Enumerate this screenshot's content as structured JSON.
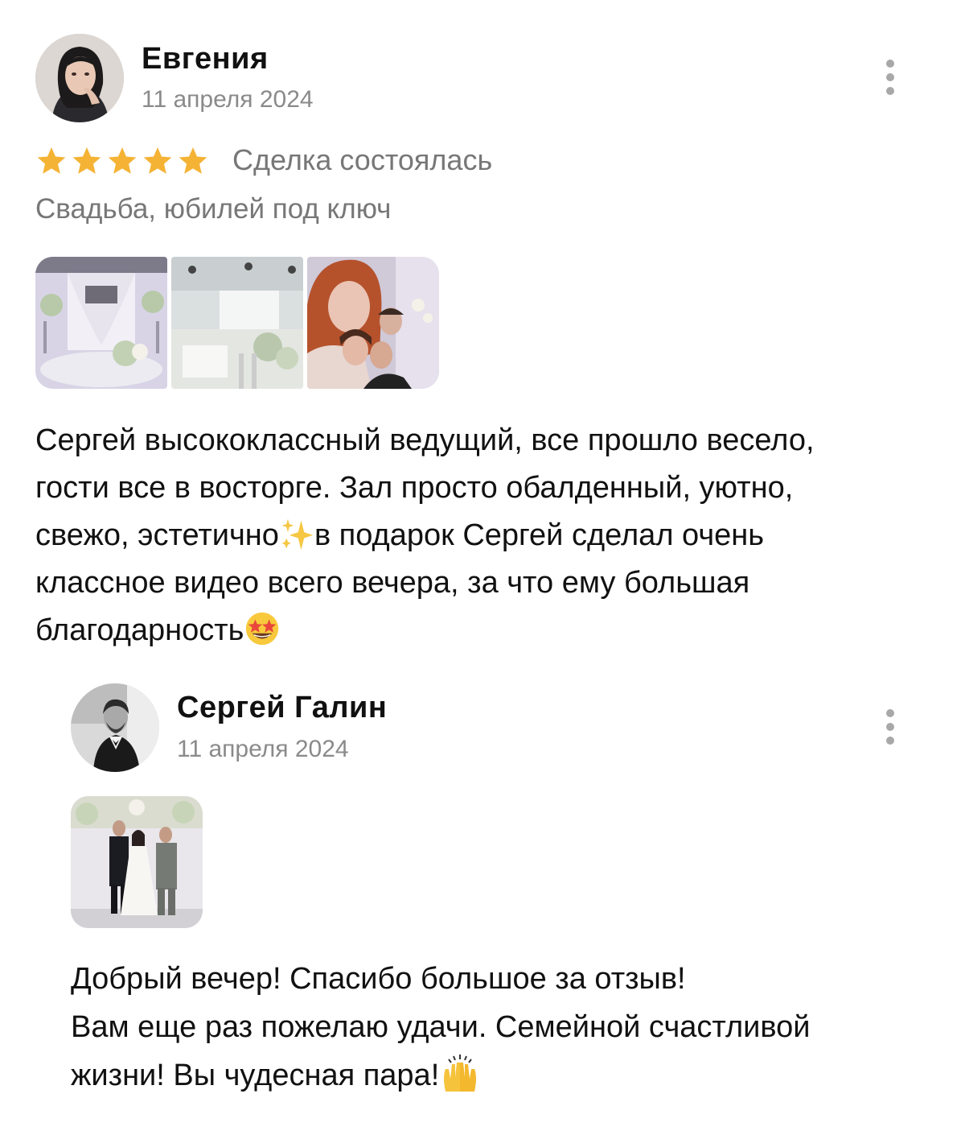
{
  "review": {
    "author": "Евгения",
    "date": "11 апреля 2024",
    "rating": 5,
    "deal_status": "Сделка состоялась",
    "service": "Свадьба, юбилей под ключ",
    "text_lines": [
      "Сергей высококлассный ведущий, все прошло весело,",
      "гости все в восторге. Зал просто обалденный, уютно,",
      "свежо, эстетично",
      "в подарок Сергей сделал очень",
      "классное видео всего вечера, за что ему большая",
      "благодарность"
    ],
    "emojis": [
      "sparkles-emoji",
      "star-struck-emoji"
    ],
    "photos": [
      "wedding-stage-photo",
      "banquet-hall-photo",
      "group-selfie-photo"
    ]
  },
  "reply": {
    "author": "Сергей Галин",
    "date": "11 апреля 2024",
    "photos": [
      "wedding-couple-photo"
    ],
    "text_lines": [
      "Добрый вечер! Спасибо большое за отзыв!",
      "Вам еще раз пожелаю удачи. Семейной счастливой",
      "жизни! Вы чудесная пара!"
    ],
    "emojis": [
      "raising-hands-emoji"
    ]
  },
  "colors": {
    "star": "#f5b335",
    "secondary_text": "#8a8a8a",
    "menu_dots": "#a8a8a8"
  }
}
